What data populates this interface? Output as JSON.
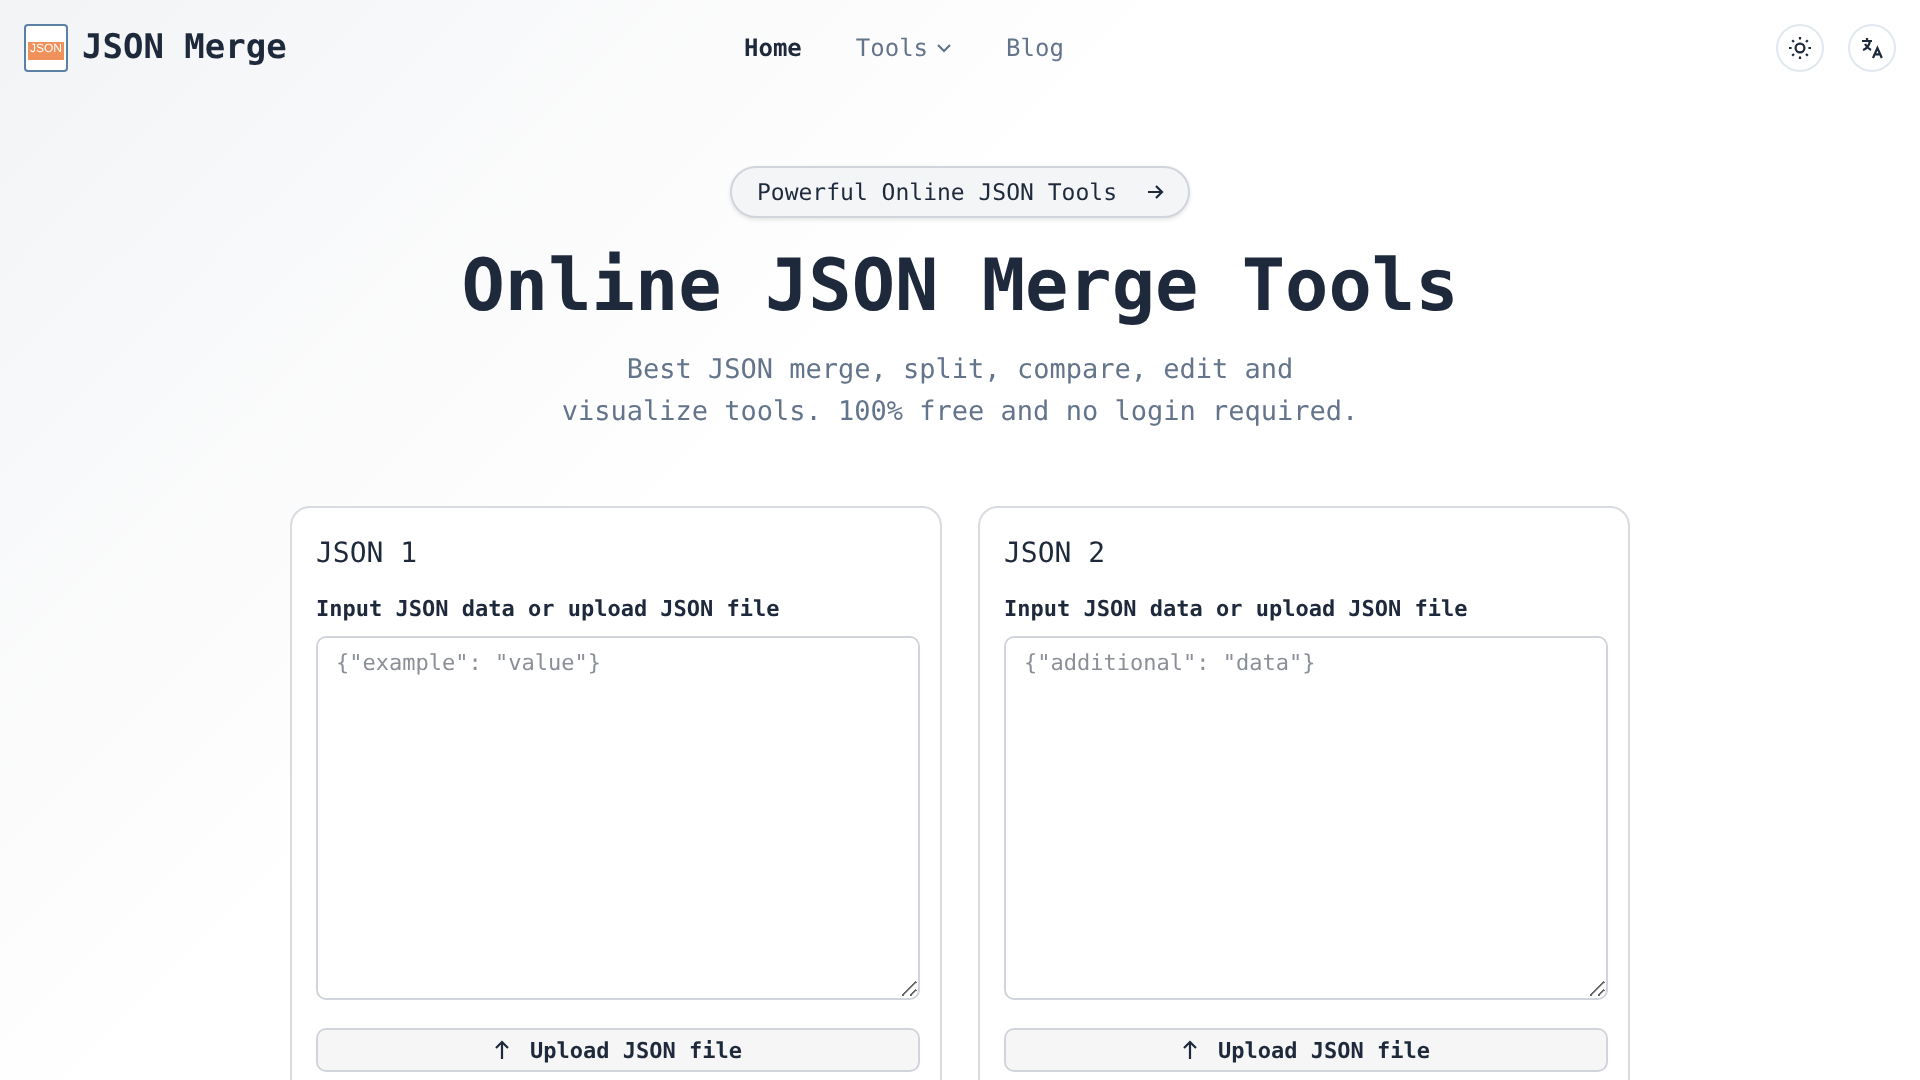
{
  "header": {
    "logo_text": "JSON",
    "title": "JSON Merge"
  },
  "nav": [
    {
      "label": "Home",
      "selected": true,
      "dropdown": false
    },
    {
      "label": "Tools",
      "selected": false,
      "dropdown": true
    },
    {
      "label": "Blog",
      "selected": false,
      "dropdown": false
    }
  ],
  "hero": {
    "badge": "Powerful Online JSON Tools",
    "title": "Online JSON Merge Tools",
    "subtitle": "Best JSON merge, split, compare, edit and visualize tools. 100% free and no login required."
  },
  "panels": [
    {
      "title": "JSON 1",
      "label": "Input JSON data or upload JSON file",
      "placeholder": "{\"example\": \"value\"}",
      "button": "Upload JSON file"
    },
    {
      "title": "JSON 2",
      "label": "Input JSON data or upload JSON file",
      "placeholder": "{\"additional\": \"data\"}",
      "button": "Upload JSON file"
    }
  ]
}
